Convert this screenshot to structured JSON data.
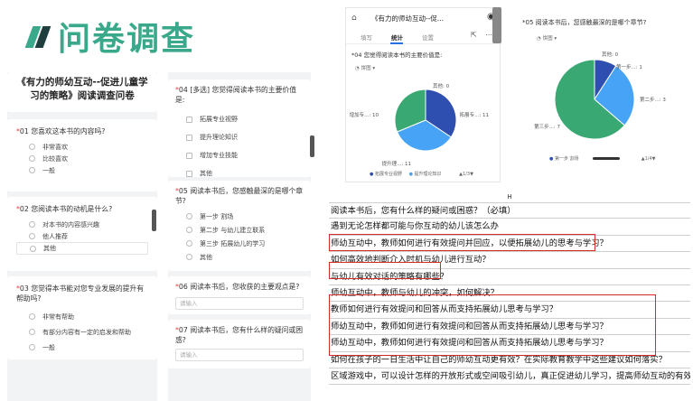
{
  "title": "问卷调查",
  "survey": {
    "title": "《有力的师幼互动--促进儿童学习的策略》阅读调查问卷",
    "q1": {
      "num": "01",
      "text": "您喜欢这本书的内容吗?",
      "options": [
        "非常喜欢",
        "比较喜欢",
        "一般"
      ]
    },
    "q2": {
      "num": "02",
      "text": "您阅读本书的动机是什么?",
      "options": [
        "对本书的内容感兴趣",
        "他人推荐",
        "其他"
      ]
    },
    "q3": {
      "num": "03",
      "text": "您觉得本书能对您专业发展的提升有帮助吗?",
      "options": [
        "非常有帮助",
        "有部分内容有一定的启发和帮助",
        "一般"
      ]
    },
    "q4": {
      "num": "04",
      "text": "[多选] 您觉得阅读本书的主要价值是:",
      "options": [
        "拓展专业视野",
        "提升理论知识",
        "增加专业技能",
        "其他"
      ]
    },
    "q5": {
      "num": "05",
      "text": "阅读本书后，您感触最深的是哪个章节?",
      "options": [
        "第一步 割场",
        "第二步 与幼儿建立联系",
        "第三步 拓展幼儿的学习",
        "其他"
      ]
    },
    "q6": {
      "num": "06",
      "text": "阅读本书后，您收获的主要观点是?",
      "placeholder": "请输入"
    },
    "q7": {
      "num": "07",
      "text": "阅读本书后，您有什么样的疑问或困惑?",
      "placeholder": "请输入"
    }
  },
  "phone1": {
    "title": "《有力的师幼互动--促...",
    "tabs": [
      "填写",
      "统计",
      "设置"
    ],
    "active_tab": "统计",
    "question": "*04 您觉得阅读本书的主要价值是:",
    "chart_type_label": "饼图",
    "legend": [
      "拓展专业视野",
      "提升理论知识"
    ],
    "pager": "1/3"
  },
  "phone2": {
    "question": "*05 阅读本书后，您感触最深的是哪个章节?",
    "chart_type_label": "饼图",
    "legend": [
      "第一步 割场"
    ],
    "pager": "1/4"
  },
  "chart_data": [
    {
      "type": "pie",
      "categories": [
        "拓展专...",
        "提升理...",
        "增加专...",
        "其他"
      ],
      "values": [
        11,
        11,
        10,
        0
      ],
      "labels": [
        "拓展专...: 11",
        "提升理...: 11",
        "增加专...: 10",
        "其他: 0"
      ],
      "colors": [
        "#2f4fb0",
        "#47a3f5",
        "#3aa873",
        "#7b5fd6"
      ]
    },
    {
      "type": "pie",
      "categories": [
        "第一步...",
        "第二步...",
        "第三步...",
        "其他"
      ],
      "values": [
        1,
        3,
        7,
        0
      ],
      "labels": [
        "第一步...: 1",
        "第二步...: 3",
        "第三步...: 7",
        "其他: 0"
      ],
      "colors": [
        "#2f4fb0",
        "#47a3f5",
        "#3aa873",
        "#7b5fd6"
      ]
    }
  ],
  "text_list": {
    "header": "H",
    "rows": [
      "阅读本书后，您有什么样的疑问或困惑？（必填）",
      "遇到无论怎样都可能与你互动的幼儿该怎么办",
      "师幼互动中，教师如何进行有效提问并回应，以便拓展幼儿的思考与学习？",
      "如何高效地判断介入时机与幼儿进行互动？",
      "与幼儿有效对话的策略有哪些？",
      "师幼互动中，教师与幼儿的冲突，如何解决？",
      "教师如何进行有效提问和回答从而支持拓展幼儿思考与学习？",
      "师幼互动中，教师如何进行有效提问和回答从而支持拓展幼儿思考与学习？",
      "师幼互动中，教师如何进行有效提问和回答从而支持拓展幼儿思考与学习？",
      "如何在孩子的一日生活中让自己的师幼互动更有效？在实际教育教学中这些建议如何落实？",
      "区域游戏中，可以设计怎样的开放形式或空间吸引幼儿，真正促进幼儿学习，提高师幼互动的有效性？"
    ]
  }
}
